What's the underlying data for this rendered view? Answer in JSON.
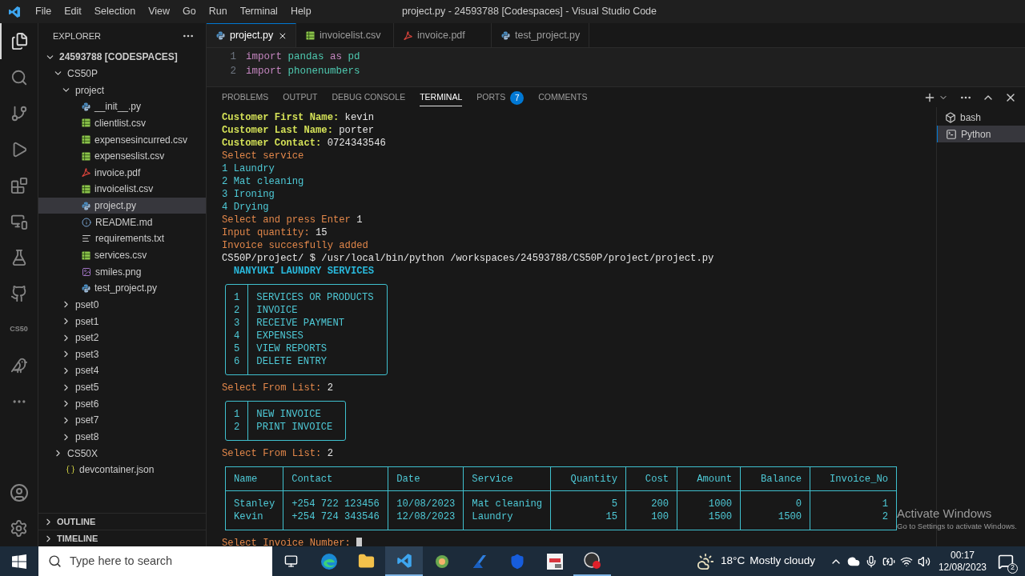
{
  "title_bar": {
    "menu": [
      "File",
      "Edit",
      "Selection",
      "View",
      "Go",
      "Run",
      "Terminal",
      "Help"
    ],
    "title": "project.py - 24593788 [Codespaces] - Visual Studio Code"
  },
  "activity_bar": {
    "cs50_label": "CS50"
  },
  "sidebar": {
    "title": "EXPLORER",
    "tree": [
      {
        "label": "24593788 [CODESPACES]",
        "kind": "root",
        "expanded": true,
        "children": [
          {
            "label": "CS50P",
            "kind": "folder",
            "expanded": true,
            "children": [
              {
                "label": "project",
                "kind": "folder",
                "expanded": true,
                "children": [
                  {
                    "label": "__init__.py",
                    "kind": "python",
                    "selected": false
                  },
                  {
                    "label": "clientlist.csv",
                    "kind": "csv",
                    "selected": false
                  },
                  {
                    "label": "expensesincurred.csv",
                    "kind": "csv",
                    "selected": false
                  },
                  {
                    "label": "expenseslist.csv",
                    "kind": "csv",
                    "selected": false
                  },
                  {
                    "label": "invoice.pdf",
                    "kind": "pdf",
                    "selected": false
                  },
                  {
                    "label": "invoicelist.csv",
                    "kind": "csv",
                    "selected": false
                  },
                  {
                    "label": "project.py",
                    "kind": "python",
                    "selected": true
                  },
                  {
                    "label": "README.md",
                    "kind": "info",
                    "selected": false
                  },
                  {
                    "label": "requirements.txt",
                    "kind": "text",
                    "selected": false
                  },
                  {
                    "label": "services.csv",
                    "kind": "csv",
                    "selected": false
                  },
                  {
                    "label": "smiles.png",
                    "kind": "image",
                    "selected": false
                  },
                  {
                    "label": "test_project.py",
                    "kind": "python",
                    "selected": false
                  }
                ]
              },
              {
                "label": "pset0",
                "kind": "folder",
                "expanded": false
              },
              {
                "label": "pset1",
                "kind": "folder",
                "expanded": false
              },
              {
                "label": "pset2",
                "kind": "folder",
                "expanded": false
              },
              {
                "label": "pset3",
                "kind": "folder",
                "expanded": false
              },
              {
                "label": "pset4",
                "kind": "folder",
                "expanded": false
              },
              {
                "label": "pset5",
                "kind": "folder",
                "expanded": false
              },
              {
                "label": "pset6",
                "kind": "folder",
                "expanded": false
              },
              {
                "label": "pset7",
                "kind": "folder",
                "expanded": false
              },
              {
                "label": "pset8",
                "kind": "folder",
                "expanded": false
              }
            ]
          },
          {
            "label": "CS50X",
            "kind": "folder",
            "expanded": false
          },
          {
            "label": "devcontainer.json",
            "kind": "json",
            "selected": false
          }
        ]
      }
    ],
    "sections": [
      {
        "label": "OUTLINE",
        "expanded": false
      },
      {
        "label": "TIMELINE",
        "expanded": false
      }
    ]
  },
  "editor": {
    "tabs": [
      {
        "label": "project.py",
        "kind": "python",
        "selected": true
      },
      {
        "label": "invoicelist.csv",
        "kind": "csv",
        "selected": false
      },
      {
        "label": "invoice.pdf",
        "kind": "pdf",
        "selected": false
      },
      {
        "label": "test_project.py",
        "kind": "python",
        "selected": false
      }
    ],
    "lines": [
      {
        "number": "1",
        "tokens": [
          {
            "text": "import",
            "kind": "keyword"
          },
          {
            "text": "pandas",
            "kind": "name"
          },
          {
            "text": "as",
            "kind": "keyword"
          },
          {
            "text": "pd",
            "kind": "name"
          }
        ]
      },
      {
        "number": "2",
        "tokens": [
          {
            "text": "import",
            "kind": "keyword"
          },
          {
            "text": "phonenumbers",
            "kind": "name"
          }
        ]
      }
    ]
  },
  "panel": {
    "tabs": [
      {
        "label": "PROBLEMS",
        "selected": false
      },
      {
        "label": "OUTPUT",
        "selected": false
      },
      {
        "label": "DEBUG CONSOLE",
        "selected": false
      },
      {
        "label": "TERMINAL",
        "selected": true
      },
      {
        "label": "PORTS",
        "selected": false,
        "badge": "7"
      },
      {
        "label": "COMMENTS",
        "selected": false
      }
    ],
    "sessions": [
      {
        "label": "bash",
        "kind": "bash",
        "selected": false
      },
      {
        "label": "Python",
        "kind": "python",
        "selected": true
      }
    ],
    "terminal": [
      {
        "kind": "line",
        "segments": [
          {
            "text": "Customer First Name:",
            "kind": "label"
          },
          {
            "text": " kevin",
            "kind": "value"
          }
        ]
      },
      {
        "kind": "line",
        "segments": [
          {
            "text": "Customer Last Name:",
            "kind": "label"
          },
          {
            "text": " porter",
            "kind": "value"
          }
        ]
      },
      {
        "kind": "line",
        "segments": [
          {
            "text": "Customer Contact:",
            "kind": "label"
          },
          {
            "text": " 0724343546",
            "kind": "value"
          }
        ]
      },
      {
        "kind": "line",
        "segments": [
          {
            "text": "Select service",
            "kind": "prompt"
          }
        ]
      },
      {
        "kind": "line",
        "segments": [
          {
            "text": "1 Laundry",
            "kind": "menu"
          }
        ]
      },
      {
        "kind": "line",
        "segments": [
          {
            "text": "2 Mat cleaning",
            "kind": "menu"
          }
        ]
      },
      {
        "kind": "line",
        "segments": [
          {
            "text": "3 Ironing",
            "kind": "menu"
          }
        ]
      },
      {
        "kind": "line",
        "segments": [
          {
            "text": "4 Drying",
            "kind": "menu"
          }
        ]
      },
      {
        "kind": "line",
        "segments": [
          {
            "text": "Select and press Enter",
            "kind": "prompt"
          },
          {
            "text": " 1",
            "kind": "value"
          }
        ]
      },
      {
        "kind": "line",
        "segments": [
          {
            "text": "Input quantity:",
            "kind": "prompt"
          },
          {
            "text": " 15",
            "kind": "value"
          }
        ]
      },
      {
        "kind": "line",
        "segments": [
          {
            "text": "Invoice succesfully added",
            "kind": "prompt"
          }
        ]
      },
      {
        "kind": "line",
        "segments": [
          {
            "text": "CS50P/project/ $ /usr/local/bin/python /workspaces/24593788/CS50P/project/project.py",
            "kind": "value"
          }
        ]
      },
      {
        "kind": "line",
        "segments": [
          {
            "text": "  NANYUKI LAUNDRY SERVICES",
            "kind": "title"
          }
        ]
      },
      {
        "kind": "menu",
        "items": [
          {
            "number": "1",
            "label": "SERVICES OR PRODUCTS"
          },
          {
            "number": "2",
            "label": "INVOICE"
          },
          {
            "number": "3",
            "label": "RECEIVE PAYMENT"
          },
          {
            "number": "4",
            "label": "EXPENSES"
          },
          {
            "number": "5",
            "label": "VIEW REPORTS"
          },
          {
            "number": "6",
            "label": "DELETE ENTRY"
          }
        ]
      },
      {
        "kind": "line",
        "segments": [
          {
            "text": "Select From List:",
            "kind": "prompt"
          },
          {
            "text": " 2",
            "kind": "value"
          }
        ]
      },
      {
        "kind": "menu",
        "items": [
          {
            "number": "1",
            "label": "NEW INVOICE"
          },
          {
            "number": "2",
            "label": "PRINT INVOICE"
          }
        ]
      },
      {
        "kind": "line",
        "segments": [
          {
            "text": "Select From List:",
            "kind": "prompt"
          },
          {
            "text": " 2",
            "kind": "value"
          }
        ]
      },
      {
        "kind": "table",
        "columns": [
          "Name",
          "Contact",
          "Date",
          "Service",
          "Quantity",
          "Cost",
          "Amount",
          "Balance",
          "Invoice_No"
        ],
        "rows": [
          [
            "Stanley",
            "+254 722 123456",
            "10/08/2023",
            "Mat cleaning",
            "5",
            "200",
            "1000",
            "0",
            "1"
          ],
          [
            "Kevin",
            "+254 724 343546",
            "12/08/2023",
            "Laundry",
            "15",
            "100",
            "1500",
            "1500",
            "2"
          ]
        ]
      },
      {
        "kind": "input",
        "segments": [
          {
            "text": "Select Invoice Number:",
            "kind": "prompt"
          }
        ]
      }
    ]
  },
  "activation_notice": {
    "title": "Activate Windows",
    "message": "Go to Settings to activate Windows."
  },
  "taskbar": {
    "search_placeholder": "Type here to search",
    "weather": {
      "temperature": "18°C",
      "condition": "Mostly cloudy"
    },
    "time": "00:17",
    "date": "12/08/2023",
    "notifications": "2"
  }
}
